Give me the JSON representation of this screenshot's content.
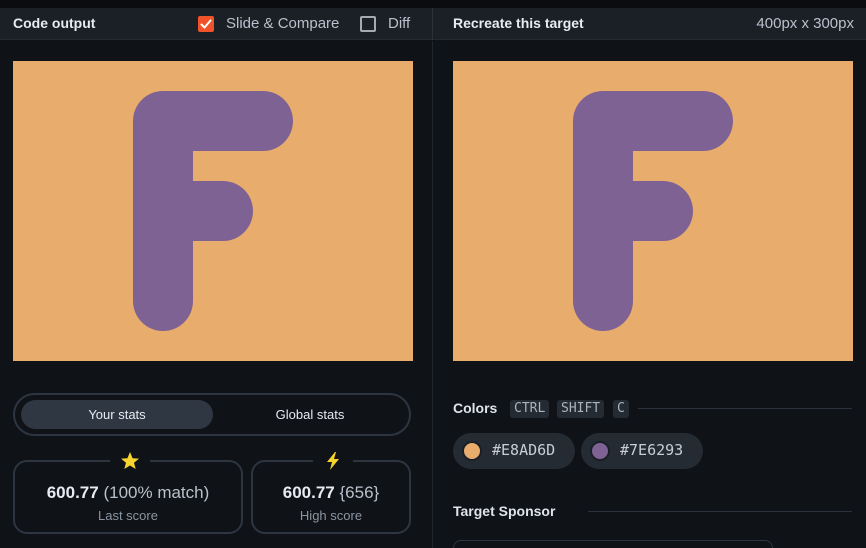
{
  "header": {
    "left_title": "Code output",
    "slide_compare": {
      "label": "Slide & Compare",
      "checked": true
    },
    "diff": {
      "label": "Diff",
      "checked": false
    },
    "right_title": "Recreate this target",
    "target_size": "400px x 300px"
  },
  "stats": {
    "tabs": [
      {
        "label": "Your stats",
        "active": true
      },
      {
        "label": "Global stats",
        "active": false
      }
    ],
    "last": {
      "score": "600.77",
      "detail": "(100% match)",
      "label": "Last score",
      "icon": "star-icon"
    },
    "high": {
      "score": "600.77",
      "detail": "{656}",
      "label": "High score",
      "icon": "lightning-icon"
    }
  },
  "colors": {
    "title": "Colors",
    "shortcut": [
      "CTRL",
      "SHIFT",
      "C"
    ],
    "swatches": [
      {
        "hex": "#E8AD6D"
      },
      {
        "hex": "#7E6293"
      }
    ]
  },
  "sponsor": {
    "title": "Target Sponsor"
  },
  "theme": {
    "background": "#e8ad6d",
    "shape": "#7e6293",
    "accent": "#f0532a"
  }
}
